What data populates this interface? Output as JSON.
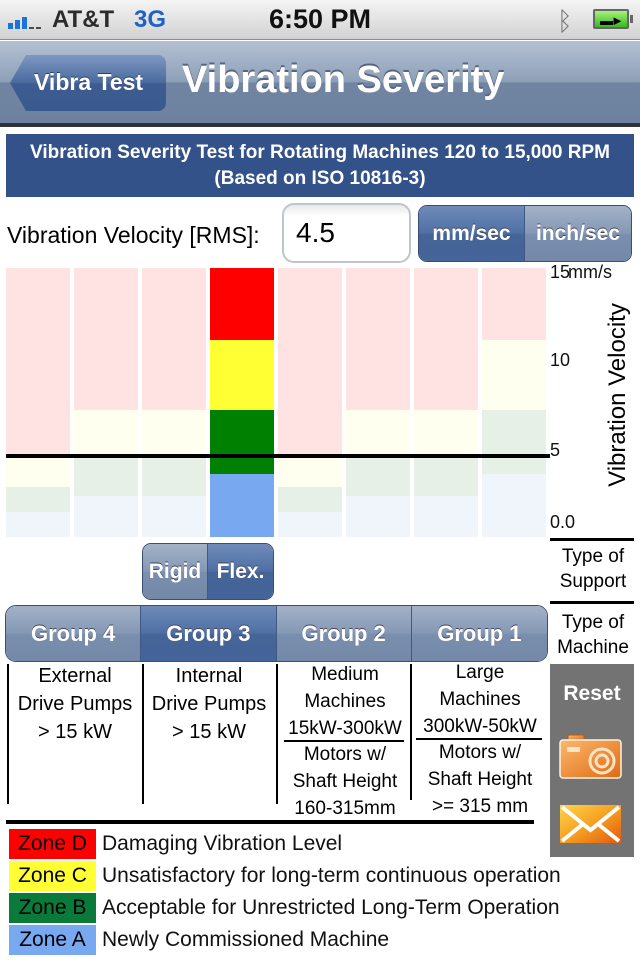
{
  "status_bar": {
    "carrier": "AT&T",
    "network": "3G",
    "time": "6:50 PM",
    "signal_bars": 3,
    "signal_bars_total": 5,
    "bluetooth_icon": "bluetooth-icon",
    "battery_icon": "battery-charging-icon"
  },
  "nav": {
    "back_label": "Vibra Test",
    "title": "Vibration Severity"
  },
  "banner": {
    "line1": "Vibration Severity Test for Rotating Machines 120 to 15,000 RPM",
    "line2": "(Based on ISO 10816-3)"
  },
  "velocity": {
    "label": "Vibration Velocity [RMS]:",
    "value": "4.5",
    "units": [
      {
        "label": "mm/sec",
        "selected": true
      },
      {
        "label": "inch/sec",
        "selected": false
      }
    ]
  },
  "colors": {
    "zone_d": "#ff0000",
    "zone_c": "#ffff33",
    "zone_b": "#008000",
    "zone_a": "#78a8f0",
    "zone_d_faded": "#ffe3e3",
    "zone_c_faded": "#fffff0",
    "zone_b_faded": "#e6f0e6",
    "zone_a_faded": "#f0f5fc",
    "banner": "#34528a"
  },
  "chart_data": {
    "type": "bar",
    "title": "",
    "ylabel": "Vibration Velocity",
    "yunit": "mm/s",
    "ylim": [
      0,
      15
    ],
    "yticks": [
      {
        "value": 15,
        "label": "15"
      },
      {
        "value": 10,
        "label": "10"
      },
      {
        "value": 5,
        "label": "5"
      },
      {
        "value": 0,
        "label": "0.0"
      }
    ],
    "measured_value": 4.5,
    "highlighted_column": 3,
    "columns": [
      {
        "group": "Group 4",
        "support": "Rigid",
        "a_b": 1.4,
        "b_c": 2.8,
        "c_d": 4.5
      },
      {
        "group": "Group 4",
        "support": "Flex.",
        "a_b": 2.3,
        "b_c": 4.5,
        "c_d": 7.1
      },
      {
        "group": "Group 3",
        "support": "Rigid",
        "a_b": 2.3,
        "b_c": 4.5,
        "c_d": 7.1
      },
      {
        "group": "Group 3",
        "support": "Flex.",
        "a_b": 3.5,
        "b_c": 7.1,
        "c_d": 11
      },
      {
        "group": "Group 2",
        "support": "Rigid",
        "a_b": 1.4,
        "b_c": 2.8,
        "c_d": 4.5
      },
      {
        "group": "Group 2",
        "support": "Flex.",
        "a_b": 2.3,
        "b_c": 4.5,
        "c_d": 7.1
      },
      {
        "group": "Group 1",
        "support": "Rigid",
        "a_b": 2.3,
        "b_c": 4.5,
        "c_d": 7.1
      },
      {
        "group": "Group 1",
        "support": "Flex.",
        "a_b": 3.5,
        "b_c": 7.1,
        "c_d": 11
      }
    ]
  },
  "support": {
    "row_label": "Type of Support",
    "options": [
      {
        "label": "Rigid",
        "selected": false
      },
      {
        "label": "Flex.",
        "selected": true
      }
    ]
  },
  "machine": {
    "row_label": "Type of Machine",
    "groups": [
      {
        "label": "Group 4",
        "selected": false
      },
      {
        "label": "Group 3",
        "selected": true
      },
      {
        "label": "Group 2",
        "selected": false
      },
      {
        "label": "Group 1",
        "selected": false
      }
    ]
  },
  "descriptions": {
    "group4": [
      "External",
      "Drive Pumps",
      "> 15 kW"
    ],
    "group3": [
      "Internal",
      "Drive Pumps",
      "> 15 kW"
    ],
    "group2_top": [
      "Medium",
      "Machines",
      "15kW-300kW"
    ],
    "group2_bottom": [
      "Motors w/",
      "Shaft Height",
      "160-315mm"
    ],
    "group1_top": [
      "Large",
      "Machines",
      "300kW-50kW"
    ],
    "group1_bottom": [
      "Motors w/",
      "Shaft Height",
      ">= 315 mm"
    ]
  },
  "actions": {
    "reset_label": "Reset",
    "camera_icon": "camera-icon",
    "mail_icon": "mail-icon"
  },
  "legend": [
    {
      "zone": "Zone D",
      "text": "Damaging Vibration Level",
      "color": "#ff0000"
    },
    {
      "zone": "Zone C",
      "text": "Unsatisfactory for long-term continuous operation",
      "color": "#ffff33"
    },
    {
      "zone": "Zone B",
      "text": "Acceptable for Unrestricted Long-Term Operation",
      "color": "#0a7a3a"
    },
    {
      "zone": "Zone A",
      "text": "Newly Commissioned Machine",
      "color": "#78a8f0"
    }
  ]
}
